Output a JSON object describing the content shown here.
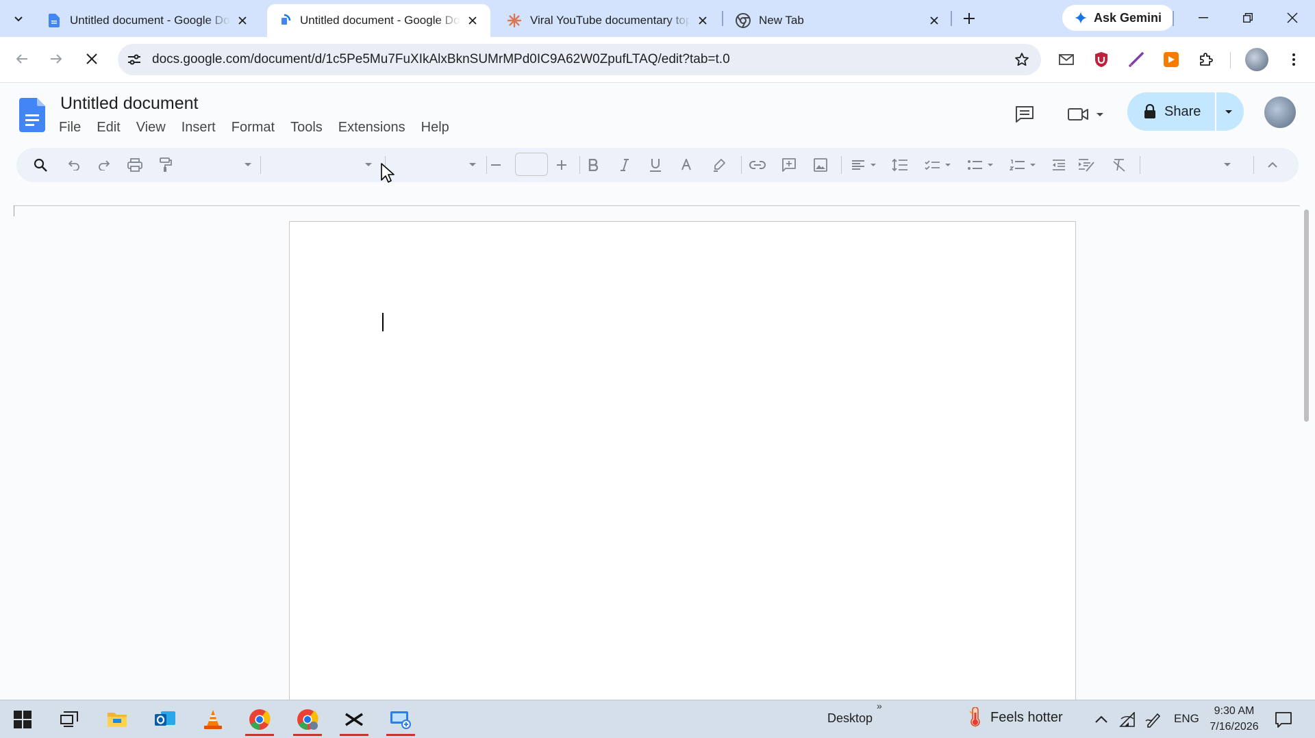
{
  "browser": {
    "tabs": [
      {
        "title": "Untitled document - Google Docs",
        "favicon": "docs-icon",
        "active": false
      },
      {
        "title": "Untitled document - Google Docs",
        "favicon": "docs-icon-loading",
        "active": true
      },
      {
        "title": "Viral YouTube documentary topics",
        "favicon": "claude-icon",
        "active": false
      },
      {
        "title": "New Tab",
        "favicon": "chrome-icon",
        "active": false
      }
    ],
    "gemini_label": "Ask Gemini",
    "url": "docs.google.com/document/d/1c5Pe5Mu7FuXIkAlxBknSUMrMPd0IC9A62W0ZpufLTAQ/edit?tab=t.0"
  },
  "docs": {
    "title": "Untitled document",
    "menu": [
      "File",
      "Edit",
      "View",
      "Insert",
      "Format",
      "Tools",
      "Extensions",
      "Help"
    ],
    "share_label": "Share"
  },
  "taskbar": {
    "desktop_label": "Desktop",
    "chevron": "»",
    "weather": "Feels hotter",
    "lang": "ENG",
    "time": "9:30 AM",
    "date": "7/16/2026"
  },
  "colors": {
    "tabstrip": "#d3e3fd",
    "share_bg": "#c2e7ff",
    "docs_blue": "#4285f4",
    "toolbar_bg": "#edf2fa"
  }
}
